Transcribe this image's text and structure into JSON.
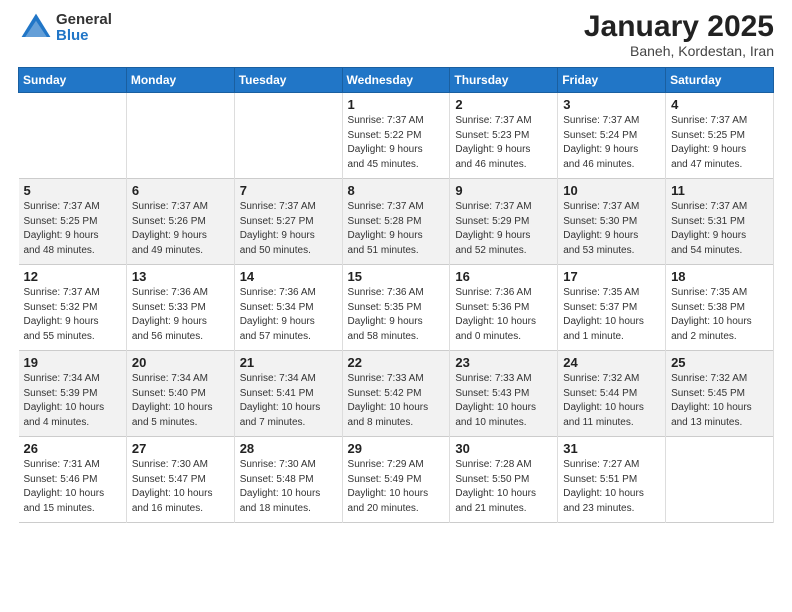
{
  "logo": {
    "general": "General",
    "blue": "Blue"
  },
  "title": {
    "month": "January 2025",
    "location": "Baneh, Kordestan, Iran"
  },
  "weekdays": [
    "Sunday",
    "Monday",
    "Tuesday",
    "Wednesday",
    "Thursday",
    "Friday",
    "Saturday"
  ],
  "weeks": [
    [
      {
        "day": "",
        "info": ""
      },
      {
        "day": "",
        "info": ""
      },
      {
        "day": "",
        "info": ""
      },
      {
        "day": "1",
        "info": "Sunrise: 7:37 AM\nSunset: 5:22 PM\nDaylight: 9 hours\nand 45 minutes."
      },
      {
        "day": "2",
        "info": "Sunrise: 7:37 AM\nSunset: 5:23 PM\nDaylight: 9 hours\nand 46 minutes."
      },
      {
        "day": "3",
        "info": "Sunrise: 7:37 AM\nSunset: 5:24 PM\nDaylight: 9 hours\nand 46 minutes."
      },
      {
        "day": "4",
        "info": "Sunrise: 7:37 AM\nSunset: 5:25 PM\nDaylight: 9 hours\nand 47 minutes."
      }
    ],
    [
      {
        "day": "5",
        "info": "Sunrise: 7:37 AM\nSunset: 5:25 PM\nDaylight: 9 hours\nand 48 minutes."
      },
      {
        "day": "6",
        "info": "Sunrise: 7:37 AM\nSunset: 5:26 PM\nDaylight: 9 hours\nand 49 minutes."
      },
      {
        "day": "7",
        "info": "Sunrise: 7:37 AM\nSunset: 5:27 PM\nDaylight: 9 hours\nand 50 minutes."
      },
      {
        "day": "8",
        "info": "Sunrise: 7:37 AM\nSunset: 5:28 PM\nDaylight: 9 hours\nand 51 minutes."
      },
      {
        "day": "9",
        "info": "Sunrise: 7:37 AM\nSunset: 5:29 PM\nDaylight: 9 hours\nand 52 minutes."
      },
      {
        "day": "10",
        "info": "Sunrise: 7:37 AM\nSunset: 5:30 PM\nDaylight: 9 hours\nand 53 minutes."
      },
      {
        "day": "11",
        "info": "Sunrise: 7:37 AM\nSunset: 5:31 PM\nDaylight: 9 hours\nand 54 minutes."
      }
    ],
    [
      {
        "day": "12",
        "info": "Sunrise: 7:37 AM\nSunset: 5:32 PM\nDaylight: 9 hours\nand 55 minutes."
      },
      {
        "day": "13",
        "info": "Sunrise: 7:36 AM\nSunset: 5:33 PM\nDaylight: 9 hours\nand 56 minutes."
      },
      {
        "day": "14",
        "info": "Sunrise: 7:36 AM\nSunset: 5:34 PM\nDaylight: 9 hours\nand 57 minutes."
      },
      {
        "day": "15",
        "info": "Sunrise: 7:36 AM\nSunset: 5:35 PM\nDaylight: 9 hours\nand 58 minutes."
      },
      {
        "day": "16",
        "info": "Sunrise: 7:36 AM\nSunset: 5:36 PM\nDaylight: 10 hours\nand 0 minutes."
      },
      {
        "day": "17",
        "info": "Sunrise: 7:35 AM\nSunset: 5:37 PM\nDaylight: 10 hours\nand 1 minute."
      },
      {
        "day": "18",
        "info": "Sunrise: 7:35 AM\nSunset: 5:38 PM\nDaylight: 10 hours\nand 2 minutes."
      }
    ],
    [
      {
        "day": "19",
        "info": "Sunrise: 7:34 AM\nSunset: 5:39 PM\nDaylight: 10 hours\nand 4 minutes."
      },
      {
        "day": "20",
        "info": "Sunrise: 7:34 AM\nSunset: 5:40 PM\nDaylight: 10 hours\nand 5 minutes."
      },
      {
        "day": "21",
        "info": "Sunrise: 7:34 AM\nSunset: 5:41 PM\nDaylight: 10 hours\nand 7 minutes."
      },
      {
        "day": "22",
        "info": "Sunrise: 7:33 AM\nSunset: 5:42 PM\nDaylight: 10 hours\nand 8 minutes."
      },
      {
        "day": "23",
        "info": "Sunrise: 7:33 AM\nSunset: 5:43 PM\nDaylight: 10 hours\nand 10 minutes."
      },
      {
        "day": "24",
        "info": "Sunrise: 7:32 AM\nSunset: 5:44 PM\nDaylight: 10 hours\nand 11 minutes."
      },
      {
        "day": "25",
        "info": "Sunrise: 7:32 AM\nSunset: 5:45 PM\nDaylight: 10 hours\nand 13 minutes."
      }
    ],
    [
      {
        "day": "26",
        "info": "Sunrise: 7:31 AM\nSunset: 5:46 PM\nDaylight: 10 hours\nand 15 minutes."
      },
      {
        "day": "27",
        "info": "Sunrise: 7:30 AM\nSunset: 5:47 PM\nDaylight: 10 hours\nand 16 minutes."
      },
      {
        "day": "28",
        "info": "Sunrise: 7:30 AM\nSunset: 5:48 PM\nDaylight: 10 hours\nand 18 minutes."
      },
      {
        "day": "29",
        "info": "Sunrise: 7:29 AM\nSunset: 5:49 PM\nDaylight: 10 hours\nand 20 minutes."
      },
      {
        "day": "30",
        "info": "Sunrise: 7:28 AM\nSunset: 5:50 PM\nDaylight: 10 hours\nand 21 minutes."
      },
      {
        "day": "31",
        "info": "Sunrise: 7:27 AM\nSunset: 5:51 PM\nDaylight: 10 hours\nand 23 minutes."
      },
      {
        "day": "",
        "info": ""
      }
    ]
  ]
}
